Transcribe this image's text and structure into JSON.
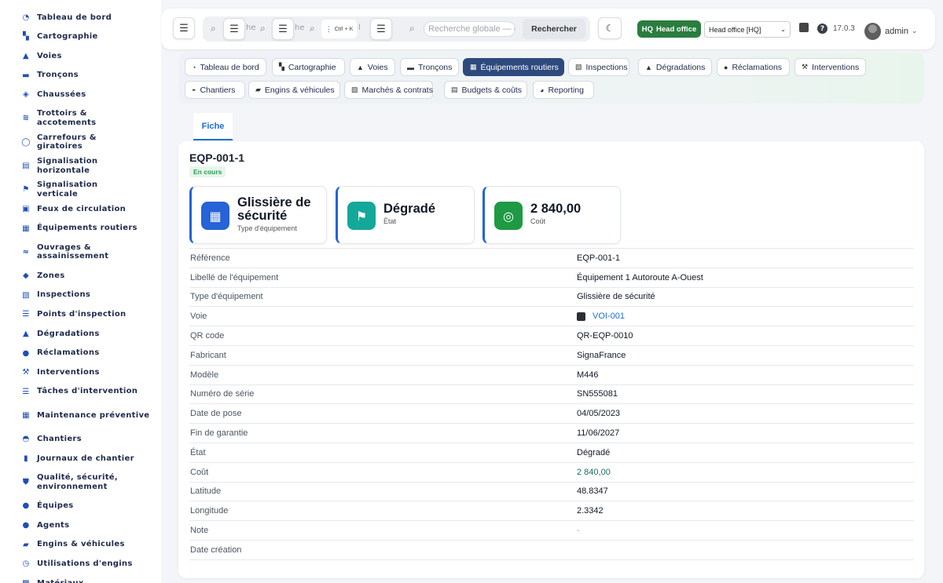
{
  "sidebar": {
    "items": [
      {
        "label": "Tableau de bord",
        "icon": "dashboard-icon",
        "glyph": "◔"
      },
      {
        "label": "Cartographie",
        "icon": "map-icon",
        "glyph": "▚"
      },
      {
        "label": "Voies",
        "icon": "road-icon",
        "glyph": "▲"
      },
      {
        "label": "Tronçons",
        "icon": "segment-icon",
        "glyph": "▬"
      },
      {
        "label": "Chaussées",
        "icon": "layers-icon",
        "glyph": "◈"
      },
      {
        "label": "Trottoirs & accotements",
        "icon": "sidewalk-icon",
        "glyph": "≋"
      },
      {
        "label": "Carrefours & giratoires",
        "icon": "roundabout-icon",
        "glyph": "◯"
      },
      {
        "label": "Signalisation horizontale",
        "icon": "road-marking-icon",
        "glyph": "▤"
      },
      {
        "label": "Signalisation verticale",
        "icon": "sign-icon",
        "glyph": "⚑"
      },
      {
        "label": "Feux de circulation",
        "icon": "traffic-light-icon",
        "glyph": "▣"
      },
      {
        "label": "Équipements routiers",
        "icon": "toolbox-icon",
        "glyph": "▦"
      },
      {
        "label": "Ouvrages & assainissement",
        "icon": "water-icon",
        "glyph": "≈"
      },
      {
        "label": "Zones",
        "icon": "zones-icon",
        "glyph": "◆"
      },
      {
        "label": "Inspections",
        "icon": "clipboard-icon",
        "glyph": "▧"
      },
      {
        "label": "Points d'inspection",
        "icon": "list-icon",
        "glyph": "☰"
      },
      {
        "label": "Dégradations",
        "icon": "warning-icon",
        "glyph": "▲"
      },
      {
        "label": "Réclamations",
        "icon": "comment-icon",
        "glyph": "●"
      },
      {
        "label": "Interventions",
        "icon": "wrench-icon",
        "glyph": "⚒"
      },
      {
        "label": "Tâches d'intervention",
        "icon": "tasks-icon",
        "glyph": "☰"
      },
      {
        "label": "Maintenance préventive",
        "icon": "calendar-icon",
        "glyph": "▦"
      },
      {
        "label": "Chantiers",
        "icon": "helmet-icon",
        "glyph": "◓"
      },
      {
        "label": "Journaux de chantier",
        "icon": "book-icon",
        "glyph": "▮"
      },
      {
        "label": "Qualité, sécurité, environnement",
        "icon": "shield-icon",
        "glyph": "⛊"
      },
      {
        "label": "Équipes",
        "icon": "team-icon",
        "glyph": "●"
      },
      {
        "label": "Agents",
        "icon": "user-icon",
        "glyph": "●"
      },
      {
        "label": "Engins & véhicules",
        "icon": "truck-icon",
        "glyph": "▰"
      },
      {
        "label": "Utilisations d'engins",
        "icon": "clock-icon",
        "glyph": "◷"
      },
      {
        "label": "Matériaux",
        "icon": "box-icon",
        "glyph": "▩"
      }
    ]
  },
  "topbar": {
    "search_placeholder": "Recherche globale — c",
    "shortcut": "Ctrl + K",
    "search_button": "Rechercher",
    "hq_badge": "HQ",
    "hq_label": "Head office",
    "office_select": "Head office [HQ]",
    "version": "17.0.3",
    "user": "admin"
  },
  "nav": {
    "row1": [
      {
        "label": "Tableau de bord",
        "icon": "dashboard-icon",
        "glyph": "◔"
      },
      {
        "label": "Cartographie",
        "icon": "map-icon",
        "glyph": "▚"
      },
      {
        "label": "Voies",
        "icon": "road-icon",
        "glyph": "▲"
      },
      {
        "label": "Tronçons",
        "icon": "segment-icon",
        "glyph": "▬"
      },
      {
        "label": "Équipements routiers",
        "icon": "toolbox-icon",
        "glyph": "▦",
        "active": true
      },
      {
        "label": "Inspections",
        "icon": "clipboard-icon",
        "glyph": "▧"
      },
      {
        "label": "Dégradations",
        "icon": "warning-icon",
        "glyph": "▲"
      },
      {
        "label": "Réclamations",
        "icon": "comment-icon",
        "glyph": "●"
      },
      {
        "label": "Interventions",
        "icon": "wrench-icon",
        "glyph": "⚒"
      }
    ],
    "row2": [
      {
        "label": "Chantiers",
        "icon": "helmet-icon",
        "glyph": "◓"
      },
      {
        "label": "Engins & véhicules",
        "icon": "truck-icon",
        "glyph": "▰"
      },
      {
        "label": "Marchés & contrats",
        "icon": "contract-icon",
        "glyph": "▨"
      },
      {
        "label": "Budgets & coûts",
        "icon": "coins-icon",
        "glyph": "▤"
      },
      {
        "label": "Reporting",
        "icon": "pie-chart-icon",
        "glyph": "◕"
      }
    ]
  },
  "tabs": {
    "fiche": "Fiche"
  },
  "record": {
    "title": "EQP-001-1",
    "status": "En cours",
    "kpis": [
      {
        "value": "Glissière de sécurité",
        "label": "Type d'équipement",
        "icon": "toolbox-icon",
        "glyph": "▦",
        "color": "#2563d6"
      },
      {
        "value": "Dégradé",
        "label": "État",
        "icon": "flag-icon",
        "glyph": "⚑",
        "color": "#14a89a"
      },
      {
        "value": "2 840,00",
        "label": "Coût",
        "icon": "coins-icon",
        "glyph": "◎",
        "color": "#1e9a44"
      }
    ],
    "fields": [
      {
        "key": "Référence",
        "value": "EQP-001-1"
      },
      {
        "key": "Libellé de l'équipement",
        "value": "Équipement 1 Autoroute A-Ouest"
      },
      {
        "key": "Type d'équipement",
        "value": "Glissière de sécurité"
      },
      {
        "key": "Voie",
        "value": "VOI-001",
        "kind": "link"
      },
      {
        "key": "QR code",
        "value": "QR-EQP-0010"
      },
      {
        "key": "Fabricant",
        "value": "SignaFrance"
      },
      {
        "key": "Modèle",
        "value": "M446"
      },
      {
        "key": "Numéro de série",
        "value": "SN555081"
      },
      {
        "key": "Date de pose",
        "value": "04/05/2023"
      },
      {
        "key": "Fin de garantie",
        "value": "11/06/2027"
      },
      {
        "key": "État",
        "value": "Dégradé"
      },
      {
        "key": "Coût",
        "value": "2 840,00",
        "kind": "money"
      },
      {
        "key": "Latitude",
        "value": "48.8347"
      },
      {
        "key": "Longitude",
        "value": "2.3342"
      },
      {
        "key": "Note",
        "value": "-",
        "kind": "muted"
      },
      {
        "key": "Date création",
        "value": ""
      }
    ]
  }
}
